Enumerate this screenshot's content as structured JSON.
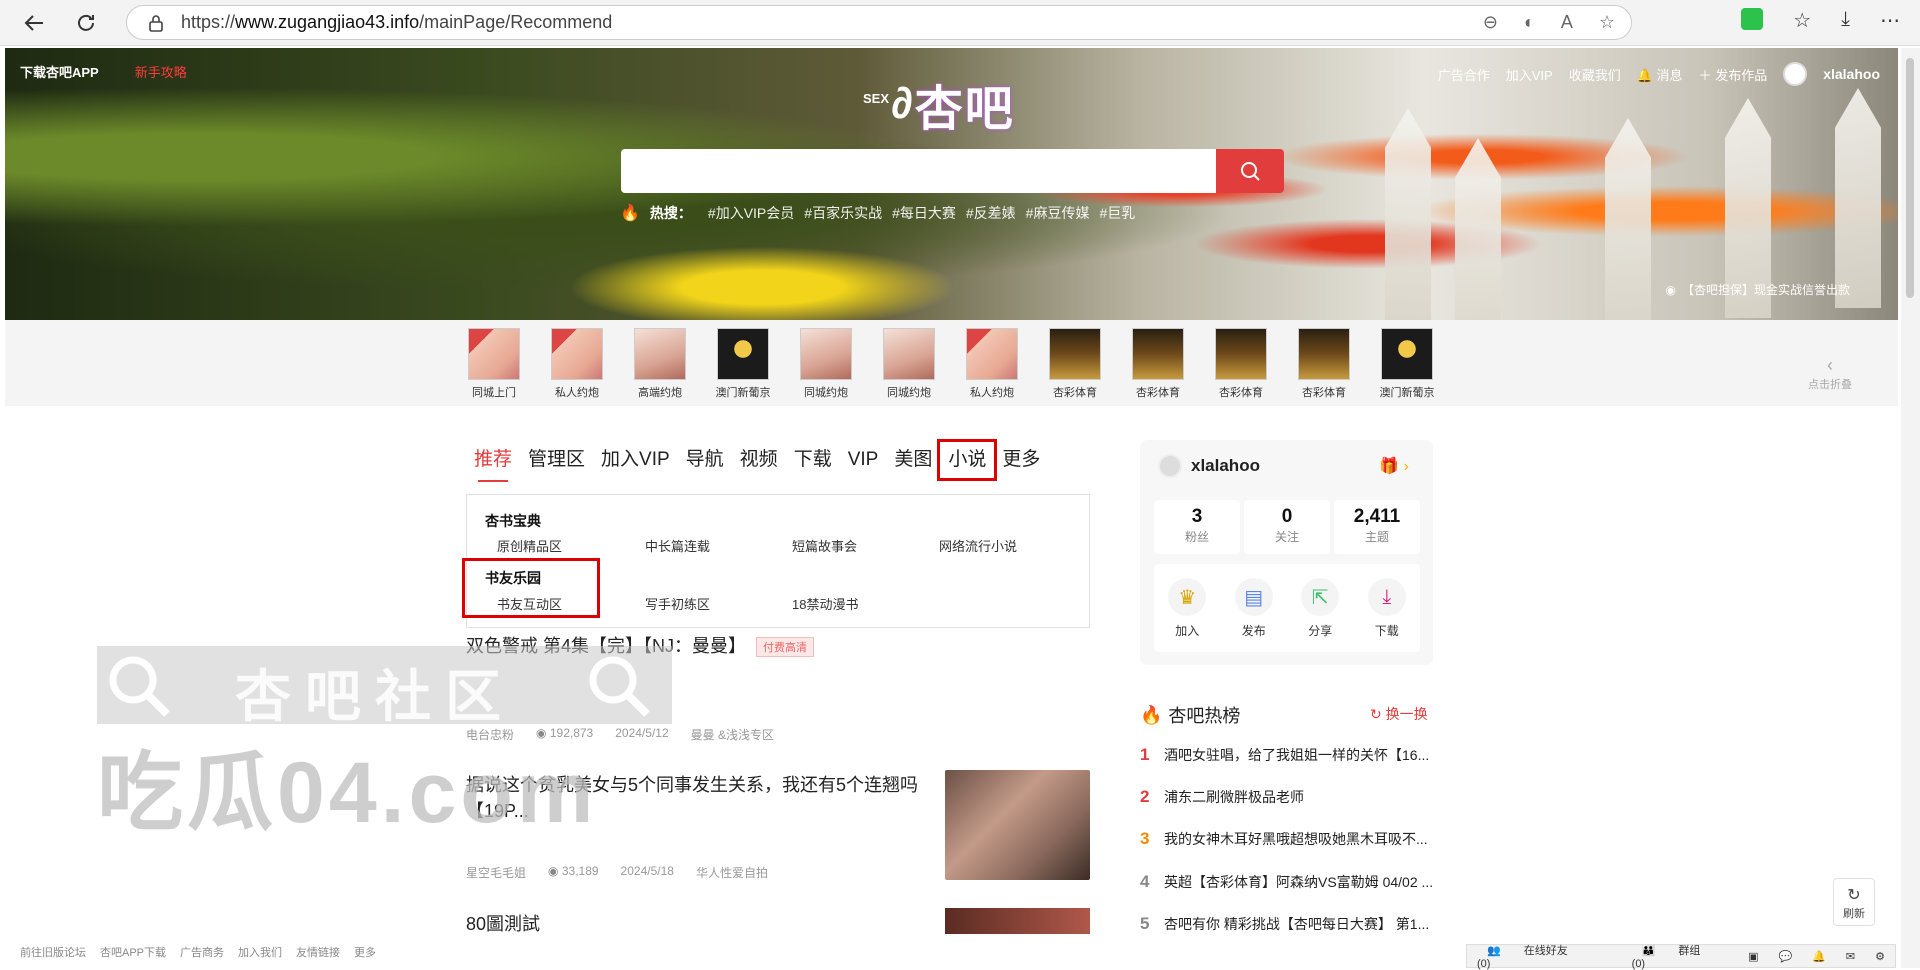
{
  "browser": {
    "url_prefix": "https://",
    "url_host": "www.zugangjiao43.info",
    "url_path": "/mainPage/Recommend"
  },
  "header": {
    "left_links": [
      "下载杏吧APP",
      "新手攻略"
    ],
    "right_links": [
      "广告合作",
      "加入VIP",
      "收藏我们",
      "消息",
      "发布作品"
    ],
    "username": "xlalahoo",
    "logo_small": "SEX",
    "logo_text": "杏吧"
  },
  "search": {
    "hot_label": "热搜：",
    "hot_tags": [
      "#加入VIP会员",
      "#百家乐实战",
      "#每日大赛",
      "#反差婊",
      "#麻豆传媒",
      "#巨乳"
    ]
  },
  "banner_notice": "【杏吧担保】现金实战信誉出款",
  "ads": {
    "items": [
      "同城上门",
      "私人约炮",
      "高端约炮",
      "澳门新葡京",
      "同城约炮",
      "同城约炮",
      "私人约炮",
      "杏彩体育",
      "杏彩体育",
      "杏彩体育",
      "杏彩体育",
      "澳门新葡京"
    ],
    "collapse_label": "点击折叠"
  },
  "tabs": [
    "推荐",
    "管理区",
    "加入VIP",
    "导航",
    "视频",
    "下载",
    "VIP",
    "美图",
    "小说",
    "更多"
  ],
  "dropdown": {
    "group1": {
      "title": "杏书宝典",
      "items": [
        "原创精品区",
        "中长篇连载",
        "短篇故事会",
        "网络流行小说"
      ]
    },
    "group2": {
      "title": "书友乐园",
      "items": [
        "书友互动区",
        "写手初练区",
        "18禁动漫书"
      ]
    }
  },
  "posts": [
    {
      "title": "双色警戒 第4集【完】【NJ：曼曼】",
      "badge": "付费高清",
      "author": "电台忠粉",
      "views": "192,873",
      "date": "2024/5/12",
      "section": "曼曼 &浅浅专区"
    },
    {
      "title": "据说这个贫乳美女与5个同事发生关系，我还有5个连翘吗【19P...",
      "author": "星空毛毛姐",
      "views": "33,189",
      "date": "2024/5/18",
      "section": "华人性爱自拍"
    },
    {
      "title": "80圖測試"
    }
  ],
  "watermark": {
    "line1": "杏吧社区",
    "line2": "吃瓜04.com"
  },
  "user_card": {
    "name": "xlalahoo",
    "stats": [
      {
        "n": "3",
        "l": "粉丝"
      },
      {
        "n": "0",
        "l": "关注"
      },
      {
        "n": "2,411",
        "l": "主题"
      }
    ],
    "actions": [
      "加入",
      "发布",
      "分享",
      "下载"
    ]
  },
  "hot_list": {
    "title": "杏吧热榜",
    "refresh": "换一换",
    "items": [
      {
        "n": "1",
        "t": "酒吧女驻唱，给了我姐姐一样的关怀【16..."
      },
      {
        "n": "2",
        "t": "浦东二刷微胖极品老师"
      },
      {
        "n": "3",
        "t": "我的女神木耳好黑哦超想吸她黑木耳吸不..."
      },
      {
        "n": "4",
        "t": "英超【杏彩体育】阿森纳VS富勒姆 04/02 ..."
      },
      {
        "n": "5",
        "t": "杏吧有你 精彩挑战【杏吧每日大赛】 第1..."
      }
    ]
  },
  "footer_links": [
    "前往旧版论坛",
    "杏吧APP下载",
    "广告商务",
    "加入我们",
    "友情链接",
    "更多"
  ],
  "float_refresh": "刷新",
  "bottom_bar": {
    "online": "在线好友(0)",
    "group": "群组(0)"
  }
}
